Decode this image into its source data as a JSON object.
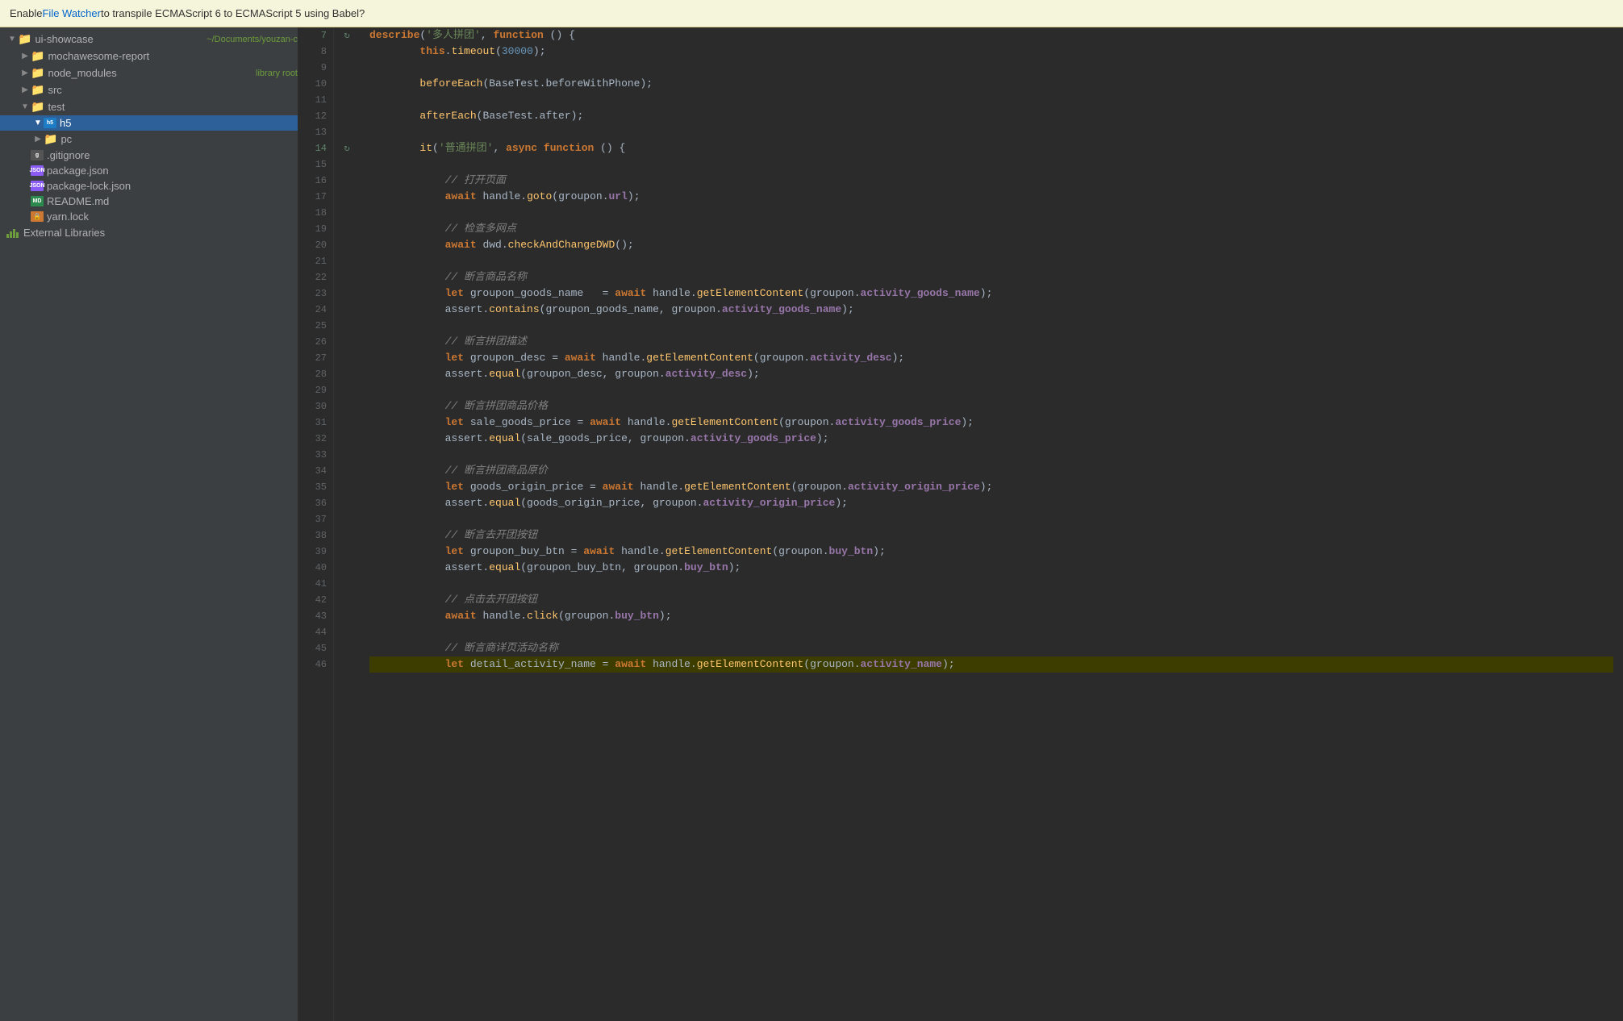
{
  "notification": {
    "text_pre": "Enable ",
    "link_text": "File Watcher",
    "text_post": " to transpile ECMAScript 6 to ECMAScript 5 using Babel?"
  },
  "sidebar": {
    "items": [
      {
        "id": "ui-showcase",
        "label": "ui-showcase",
        "badge": "~/Documents/youzan-c",
        "indent": 0,
        "type": "folder",
        "state": "open",
        "selected": false
      },
      {
        "id": "mochawesome-report",
        "label": "mochawesome-report",
        "badge": "",
        "indent": 1,
        "type": "folder",
        "state": "closed",
        "selected": false
      },
      {
        "id": "node_modules",
        "label": "node_modules",
        "badge": "library root",
        "indent": 1,
        "type": "folder",
        "state": "closed",
        "selected": false
      },
      {
        "id": "src",
        "label": "src",
        "badge": "",
        "indent": 1,
        "type": "folder",
        "state": "closed",
        "selected": false
      },
      {
        "id": "test",
        "label": "test",
        "badge": "",
        "indent": 1,
        "type": "folder",
        "state": "open",
        "selected": false
      },
      {
        "id": "h5",
        "label": "h5",
        "badge": "",
        "indent": 2,
        "type": "folder-special",
        "state": "open",
        "selected": true
      },
      {
        "id": "pc",
        "label": "pc",
        "badge": "",
        "indent": 2,
        "type": "folder",
        "state": "closed",
        "selected": false
      },
      {
        "id": "gitignore",
        "label": ".gitignore",
        "badge": "",
        "indent": 1,
        "type": "file-gitignore",
        "state": "none",
        "selected": false
      },
      {
        "id": "package_json",
        "label": "package.json",
        "badge": "",
        "indent": 1,
        "type": "file-json",
        "state": "none",
        "selected": false
      },
      {
        "id": "package_lock_json",
        "label": "package-lock.json",
        "badge": "",
        "indent": 1,
        "type": "file-json",
        "state": "none",
        "selected": false
      },
      {
        "id": "readme_md",
        "label": "README.md",
        "badge": "",
        "indent": 1,
        "type": "file-md",
        "state": "none",
        "selected": false
      },
      {
        "id": "yarn_lock",
        "label": "yarn.lock",
        "badge": "",
        "indent": 1,
        "type": "file-lock",
        "state": "none",
        "selected": false
      }
    ],
    "external_libraries": "External Libraries"
  },
  "code": {
    "lines": [
      {
        "num": 7,
        "gutter": "run",
        "content_html": "<span class='kw'>describe</span>(<span class='str'>'多人拼团'</span>, <span class='kw'>function</span> () {",
        "highlight": false
      },
      {
        "num": 8,
        "gutter": "",
        "content_html": "        <span class='kw'>this</span>.<span class='fn'>timeout</span>(<span class='num'>30000</span>);",
        "highlight": false
      },
      {
        "num": 9,
        "gutter": "",
        "content_html": "",
        "highlight": false
      },
      {
        "num": 10,
        "gutter": "",
        "content_html": "        <span class='fn'>beforeEach</span>(BaseTest.<span class='mt'>beforeWithPhone</span>);",
        "highlight": false
      },
      {
        "num": 11,
        "gutter": "",
        "content_html": "",
        "highlight": false
      },
      {
        "num": 12,
        "gutter": "",
        "content_html": "        <span class='fn'>afterEach</span>(BaseTest.<span class='mt'>after</span>);",
        "highlight": false
      },
      {
        "num": 13,
        "gutter": "",
        "content_html": "",
        "highlight": false
      },
      {
        "num": 14,
        "gutter": "run-arrow",
        "content_html": "        <span class='fn'>it</span>(<span class='str'>'普通拼团'</span>, <span class='kw'>async</span> <span class='kw'>function</span> () {",
        "highlight": false
      },
      {
        "num": 15,
        "gutter": "",
        "content_html": "",
        "highlight": false
      },
      {
        "num": 16,
        "gutter": "",
        "content_html": "            <span class='cm'>// 打开页面</span>",
        "highlight": false
      },
      {
        "num": 17,
        "gutter": "",
        "content_html": "            <span class='kw'>await</span> handle.<span class='fn'>goto</span>(groupon.<span class='prop'>url</span>);",
        "highlight": false
      },
      {
        "num": 18,
        "gutter": "",
        "content_html": "",
        "highlight": false
      },
      {
        "num": 19,
        "gutter": "",
        "content_html": "            <span class='cm'>// 检查多网点</span>",
        "highlight": false
      },
      {
        "num": 20,
        "gutter": "",
        "content_html": "            <span class='kw'>await</span> dwd.<span class='fn'>checkAndChangeDWD</span>();",
        "highlight": false
      },
      {
        "num": 21,
        "gutter": "",
        "content_html": "",
        "highlight": false
      },
      {
        "num": 22,
        "gutter": "",
        "content_html": "            <span class='cm'>// 断言商品名称</span>",
        "highlight": false
      },
      {
        "num": 23,
        "gutter": "",
        "content_html": "            <span class='kw'>let</span> groupon_goods_name   = <span class='kw'>await</span> handle.<span class='fn'>getElementContent</span>(groupon.<span class='prop'>activity_goods_name</span>);",
        "highlight": false
      },
      {
        "num": 24,
        "gutter": "",
        "content_html": "            assert.<span class='fn'>contains</span>(groupon_goods_name, groupon.<span class='prop'>activity_goods_name</span>);",
        "highlight": false
      },
      {
        "num": 25,
        "gutter": "",
        "content_html": "",
        "highlight": false
      },
      {
        "num": 26,
        "gutter": "",
        "content_html": "            <span class='cm'>// 断言拼团描述</span>",
        "highlight": false
      },
      {
        "num": 27,
        "gutter": "",
        "content_html": "            <span class='kw'>let</span> groupon_desc = <span class='kw'>await</span> handle.<span class='fn'>getElementContent</span>(groupon.<span class='prop'>activity_desc</span>);",
        "highlight": false
      },
      {
        "num": 28,
        "gutter": "",
        "content_html": "            assert.<span class='fn'>equal</span>(groupon_desc, groupon.<span class='prop'>activity_desc</span>);",
        "highlight": false
      },
      {
        "num": 29,
        "gutter": "",
        "content_html": "",
        "highlight": false
      },
      {
        "num": 30,
        "gutter": "",
        "content_html": "            <span class='cm'>// 断言拼团商品价格</span>",
        "highlight": false
      },
      {
        "num": 31,
        "gutter": "",
        "content_html": "            <span class='kw'>let</span> sale_goods_price = <span class='kw'>await</span> handle.<span class='fn'>getElementContent</span>(groupon.<span class='prop'>activity_goods_price</span>);",
        "highlight": false
      },
      {
        "num": 32,
        "gutter": "",
        "content_html": "            assert.<span class='fn'>equal</span>(sale_goods_price, groupon.<span class='prop'>activity_goods_price</span>);",
        "highlight": false
      },
      {
        "num": 33,
        "gutter": "",
        "content_html": "",
        "highlight": false
      },
      {
        "num": 34,
        "gutter": "",
        "content_html": "            <span class='cm'>// 断言拼团商品原价</span>",
        "highlight": false
      },
      {
        "num": 35,
        "gutter": "",
        "content_html": "            <span class='kw'>let</span> goods_origin_price = <span class='kw'>await</span> handle.<span class='fn'>getElementContent</span>(groupon.<span class='prop'>activity_origin_price</span>);",
        "highlight": false
      },
      {
        "num": 36,
        "gutter": "",
        "content_html": "            assert.<span class='fn'>equal</span>(goods_origin_price, groupon.<span class='prop'>activity_origin_price</span>);",
        "highlight": false
      },
      {
        "num": 37,
        "gutter": "",
        "content_html": "",
        "highlight": false
      },
      {
        "num": 38,
        "gutter": "",
        "content_html": "            <span class='cm'>// 断言去开团按钮</span>",
        "highlight": false
      },
      {
        "num": 39,
        "gutter": "",
        "content_html": "            <span class='kw'>let</span> groupon_buy_btn = <span class='kw'>await</span> handle.<span class='fn'>getElementContent</span>(groupon.<span class='prop'>buy_btn</span>);",
        "highlight": false
      },
      {
        "num": 40,
        "gutter": "",
        "content_html": "            assert.<span class='fn'>equal</span>(groupon_buy_btn, groupon.<span class='prop'>buy_btn</span>);",
        "highlight": false
      },
      {
        "num": 41,
        "gutter": "",
        "content_html": "",
        "highlight": false
      },
      {
        "num": 42,
        "gutter": "",
        "content_html": "            <span class='cm'>// 点击去开团按钮</span>",
        "highlight": false
      },
      {
        "num": 43,
        "gutter": "",
        "content_html": "            <span class='kw'>await</span> handle.<span class='fn'>click</span>(groupon.<span class='prop'>buy_btn</span>);",
        "highlight": false
      },
      {
        "num": 44,
        "gutter": "",
        "content_html": "",
        "highlight": false
      },
      {
        "num": 45,
        "gutter": "",
        "content_html": "            <span class='cm'>// 断言商详页活动名称</span>",
        "highlight": false
      },
      {
        "num": 46,
        "gutter": "",
        "content_html": "            <span class='kw'>let</span> detail_activity_name = <span class='kw'>await</span> handle.<span class='fn'>getElementContent</span>(groupon.<span class='prop'>activity_name</span>);",
        "highlight": true
      }
    ]
  }
}
